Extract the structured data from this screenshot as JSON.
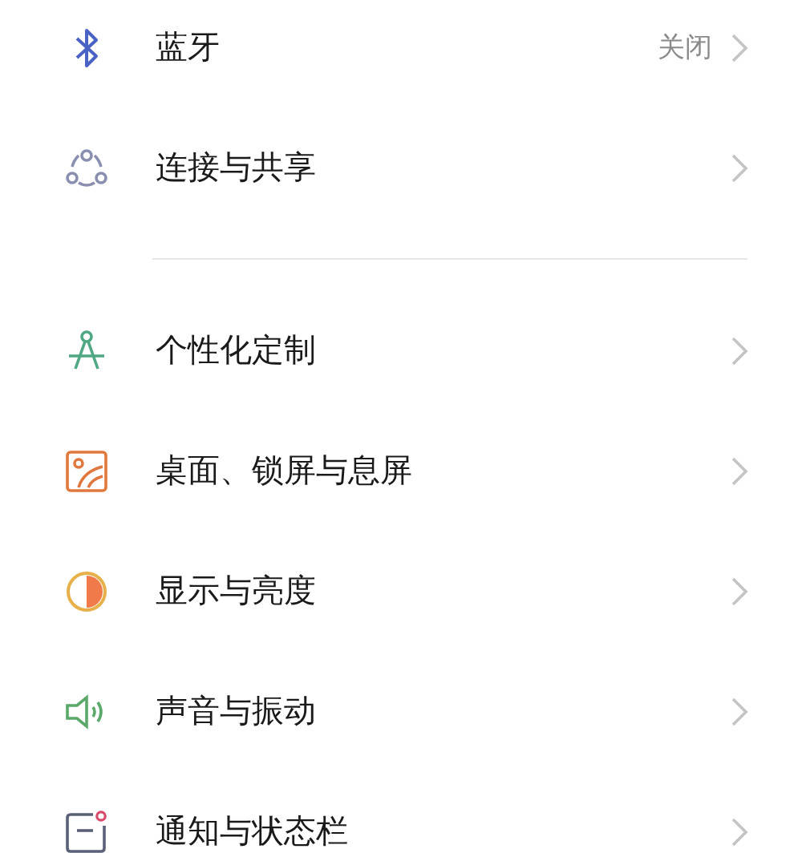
{
  "sections": [
    {
      "items": [
        {
          "label": "蓝牙",
          "value": "关闭"
        },
        {
          "label": "连接与共享"
        }
      ]
    },
    {
      "items": [
        {
          "label": "个性化定制"
        },
        {
          "label": "桌面、锁屏与息屏"
        },
        {
          "label": "显示与亮度"
        },
        {
          "label": "声音与振动"
        },
        {
          "label": "通知与状态栏"
        }
      ]
    }
  ]
}
